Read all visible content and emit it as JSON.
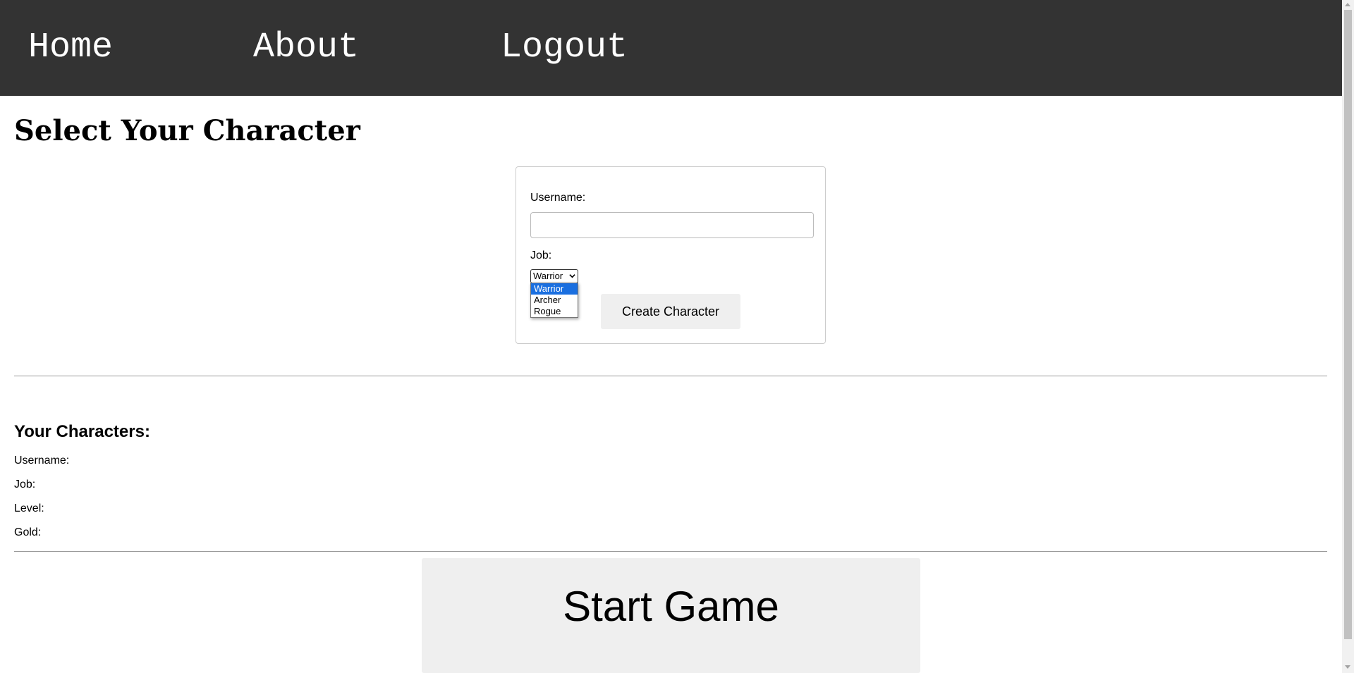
{
  "nav": {
    "home": "Home",
    "about": "About",
    "logout": "Logout"
  },
  "page": {
    "title": "Select Your Character"
  },
  "form": {
    "username_label": "Username:",
    "username_value": "",
    "job_label": "Job:",
    "job_selected": "Warrior",
    "job_options": [
      "Warrior",
      "Archer",
      "Rogue"
    ],
    "create_button": "Create Character"
  },
  "characters": {
    "title": "Your Characters:",
    "username_label": "Username:",
    "job_label": "Job:",
    "level_label": "Level:",
    "gold_label": "Gold:"
  },
  "start_button": "Start Game",
  "colors": {
    "navbar_bg": "#333333",
    "button_bg": "#efefef",
    "selected_option_bg": "#1a6fe0"
  }
}
